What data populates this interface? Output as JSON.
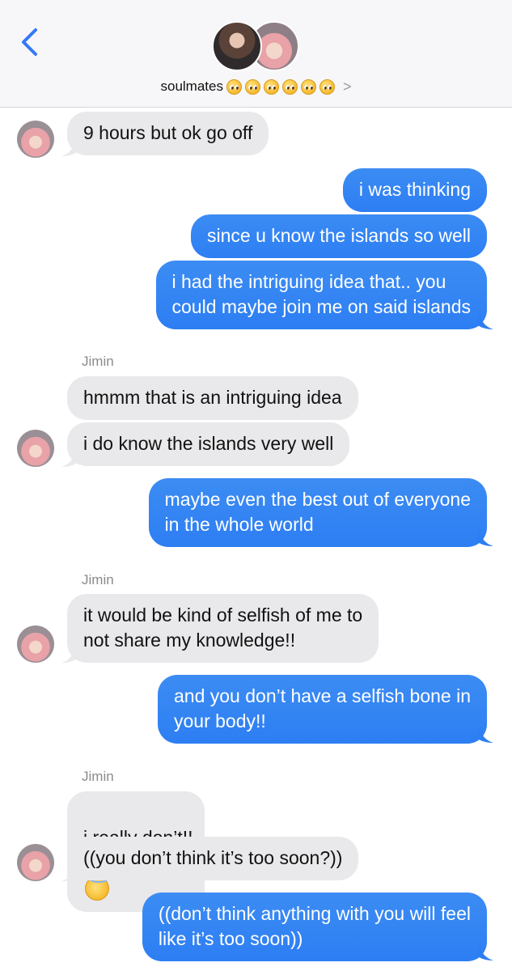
{
  "header": {
    "title": "soulmates",
    "title_emojis": [
      "pleading-face",
      "pleading-face",
      "pleading-face",
      "pleading-face",
      "pleading-face",
      "pleading-face"
    ],
    "chevron": ">"
  },
  "colors": {
    "outgoing_bubble": "#2d7ef3",
    "incoming_bubble": "#e9e9eb",
    "back_arrow": "#3478f6"
  },
  "messages": [
    {
      "from": "them",
      "text": "9 hours but ok go off"
    },
    {
      "from": "me",
      "text": "i was thinking"
    },
    {
      "from": "me",
      "text": "since u know the islands so well"
    },
    {
      "from": "me",
      "text": "i had the intriguing idea that.. you\ncould maybe join me on said islands"
    },
    {
      "from": "them",
      "sender": "Jimin",
      "text": "hmmm that is an intriguing idea"
    },
    {
      "from": "them",
      "text": "i do know the islands very well"
    },
    {
      "from": "me",
      "text": "maybe even the best out of everyone\nin the whole world"
    },
    {
      "from": "them",
      "sender": "Jimin",
      "text": "it would be kind of selfish of me to\nnot share my knowledge!!"
    },
    {
      "from": "me",
      "text": "and you don’t have a selfish bone in\nyour body!!"
    },
    {
      "from": "them",
      "sender": "Jimin",
      "text": "i really don’t!!",
      "emojis": [
        "smiling-face-with-halo",
        "smiling-face-with-halo"
      ]
    },
    {
      "from": "them",
      "text": "((you don’t think it’s too soon?))"
    },
    {
      "from": "me",
      "text": "((don’t think anything with you will feel\nlike it’s too soon))"
    }
  ]
}
